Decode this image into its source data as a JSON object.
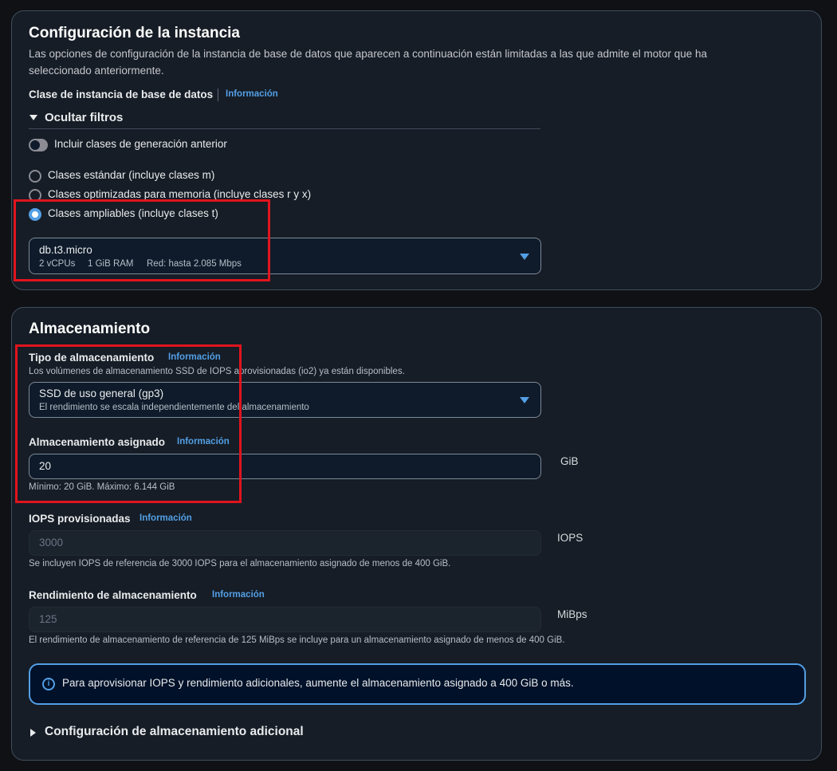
{
  "instance": {
    "title": "Configuración de la instancia",
    "description": "Las opciones de configuración de la instancia de base de datos que aparecen a continuación están limitadas a las que admite el motor que ha seleccionado anteriormente.",
    "class_label": "Clase de instancia de base de datos",
    "info_label": "Información",
    "filters_toggle_label": "Ocultar filtros",
    "previous_gen_toggle": {
      "label": "Incluir clases de generación anterior",
      "checked": false
    },
    "class_options": [
      {
        "label": "Clases estándar (incluye clases m)",
        "selected": false
      },
      {
        "label": "Clases optimizadas para memoria (incluye clases r y x)",
        "selected": false
      },
      {
        "label": "Clases ampliables (incluye clases t)",
        "selected": true
      }
    ],
    "selected_class": {
      "name": "db.t3.micro",
      "vcpus": "2 vCPUs",
      "ram": "1 GiB RAM",
      "network": "Red: hasta 2.085 Mbps"
    }
  },
  "storage": {
    "title": "Almacenamiento",
    "type": {
      "label": "Tipo de almacenamiento",
      "info_label": "Información",
      "description": "Los volúmenes de almacenamiento SSD de IOPS aprovisionadas (io2) ya están disponibles.",
      "value": "SSD de uso general (gp3)",
      "value_description": "El rendimiento se escala independientemente del almacenamiento"
    },
    "allocated": {
      "label": "Almacenamiento asignado",
      "info_label": "Información",
      "value": "20",
      "unit": "GiB",
      "hint": "Mínimo: 20 GiB. Máximo: 6.144 GiB"
    },
    "iops": {
      "label": "IOPS provisionadas",
      "info_label": "Información",
      "placeholder": "3000",
      "unit": "IOPS",
      "hint": "Se incluyen IOPS de referencia de 3000 IOPS para el almacenamiento asignado de menos de 400 GiB."
    },
    "throughput": {
      "label": "Rendimiento de almacenamiento",
      "info_label": "Información",
      "placeholder": "125",
      "unit": "MiBps",
      "hint": "El rendimiento de almacenamiento de referencia de 125 MiBps se incluye para un almacenamiento asignado de menos de 400 GiB."
    },
    "alert_text": "Para aprovisionar IOPS y rendimiento adicionales, aumente el almacenamiento asignado a 400 GiB o más.",
    "additional_config_label": "Configuración de almacenamiento adicional"
  },
  "colors": {
    "accent": "#539fe5",
    "highlight_box": "#e0141e",
    "panel_bg": "#161d26",
    "page_bg": "#0f1115"
  }
}
